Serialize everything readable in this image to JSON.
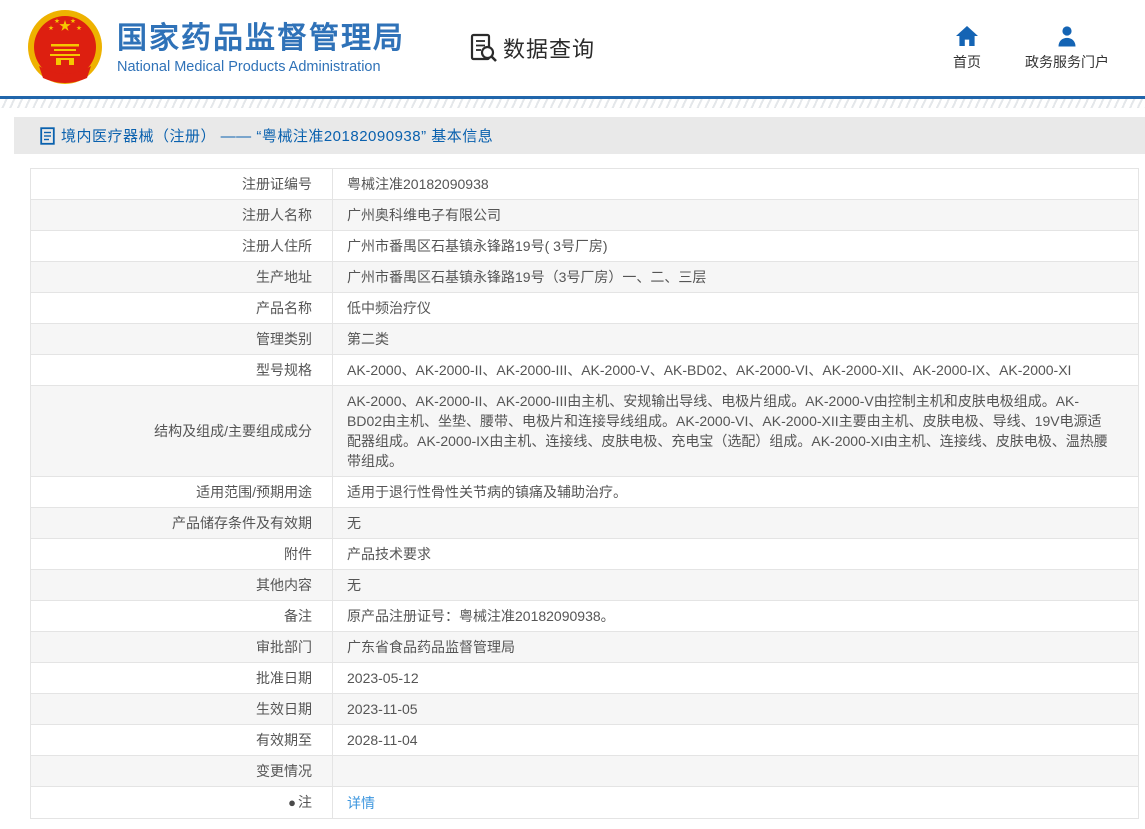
{
  "colors": {
    "accent_blue": "#2f72b8",
    "title_blue": "#0a61ae",
    "link_blue": "#3e97df",
    "icon_blue": "#1464b4"
  },
  "header": {
    "org_name_cn": "国家药品监督管理局",
    "org_name_en": "National Medical Products Administration",
    "nav_data_query": "数据查询",
    "nav_home": "首页",
    "nav_portal": "政务服务门户"
  },
  "page_title": {
    "text": "境内医疗器械（注册） —— “粤械注准20182090938” 基本信息"
  },
  "table": {
    "rows": [
      {
        "label": "注册证编号",
        "value": "粤械注准20182090938"
      },
      {
        "label": "注册人名称",
        "value": "广州奥科维电子有限公司"
      },
      {
        "label": "注册人住所",
        "value": "广州市番禺区石基镇永锋路19号( 3号厂房)"
      },
      {
        "label": "生产地址",
        "value": "广州市番禺区石基镇永锋路19号（3号厂房）一、二、三层"
      },
      {
        "label": "产品名称",
        "value": "低中频治疗仪"
      },
      {
        "label": "管理类别",
        "value": "第二类"
      },
      {
        "label": "型号规格",
        "value": "AK-2000、AK-2000-II、AK-2000-III、AK-2000-V、AK-BD02、AK-2000-VI、AK-2000-XII、AK-2000-IX、AK-2000-XI"
      },
      {
        "label": "结构及组成/主要组成成分",
        "value": "AK-2000、AK-2000-II、AK-2000-III由主机、安规输出导线、电极片组成。AK-2000-V由控制主机和皮肤电极组成。AK-BD02由主机、坐垫、腰带、电极片和连接导线组成。AK-2000-VI、AK-2000-XII主要由主机、皮肤电极、导线、19V电源适配器组成。AK-2000-IX由主机、连接线、皮肤电极、充电宝（选配）组成。AK-2000-XI由主机、连接线、皮肤电极、温热腰带组成。"
      },
      {
        "label": "适用范围/预期用途",
        "value": "适用于退行性骨性关节病的镇痛及辅助治疗。"
      },
      {
        "label": "产品储存条件及有效期",
        "value": "无"
      },
      {
        "label": "附件",
        "value": "产品技术要求"
      },
      {
        "label": "其他内容",
        "value": "无"
      },
      {
        "label": "备注",
        "value": "原产品注册证号：粤械注准20182090938。"
      },
      {
        "label": "审批部门",
        "value": "广东省食品药品监督管理局"
      },
      {
        "label": "批准日期",
        "value": "2023-05-12"
      },
      {
        "label": "生效日期",
        "value": "2023-11-05"
      },
      {
        "label": "有效期至",
        "value": "2028-11-04"
      },
      {
        "label": "变更情况",
        "value": ""
      },
      {
        "label": "注",
        "label_icon": "●",
        "value": "详情",
        "link": true
      }
    ]
  }
}
